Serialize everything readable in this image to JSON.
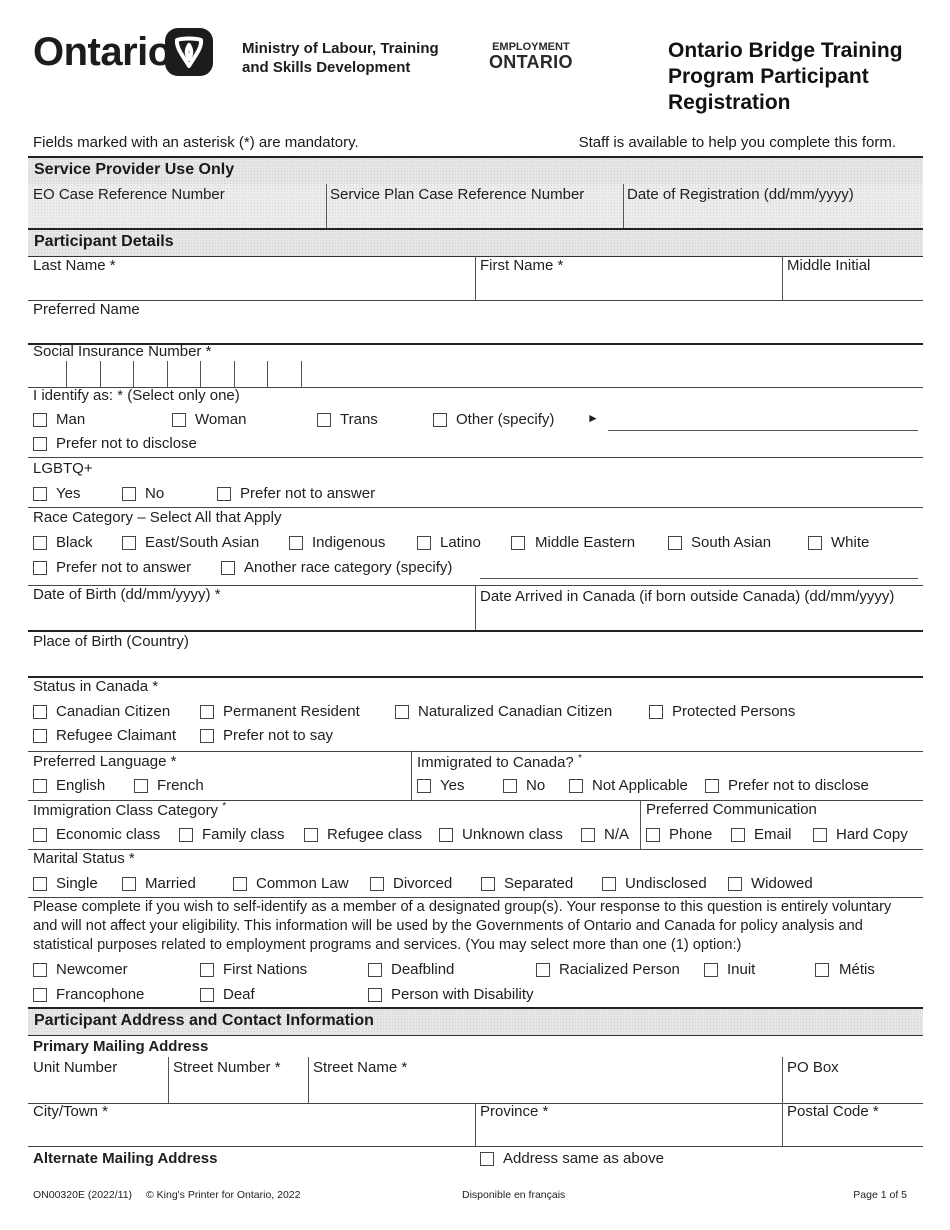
{
  "header": {
    "logo_text": "Ontario",
    "logo_icon": "trillium-icon",
    "ministry_line1": "Ministry of Labour, Training",
    "ministry_line2": "and Skills Development",
    "eo_line1": "EMPLOYMENT",
    "eo_line2": "ONTARIO",
    "title_line1": "Ontario Bridge Training",
    "title_line2": "Program Participant",
    "title_line3": "Registration"
  },
  "notes": {
    "mandatory": "Fields marked with an asterisk (*) are mandatory.",
    "staff": "Staff is available to help you complete this form."
  },
  "service_provider": {
    "heading": "Service Provider Use Only",
    "fields": [
      "EO Case Reference Number",
      "Service Plan Case Reference Number",
      "Date of Registration (dd/mm/yyyy)"
    ]
  },
  "participant": {
    "heading": "Participant Details",
    "last_name": "Last Name *",
    "first_name": "First Name *",
    "middle_initial": "Middle Initial",
    "preferred_name": "Preferred Name",
    "sin": "Social Insurance Number *",
    "identify": {
      "label": "I identify as: * (Select only one)",
      "options": [
        "Man",
        "Woman",
        "Trans",
        "Other (specify)",
        "Prefer not to disclose"
      ],
      "arrow": "►"
    },
    "lgbtq": {
      "label": "LGBTQ+",
      "options": [
        "Yes",
        "No",
        "Prefer not to answer"
      ]
    },
    "race": {
      "label": "Race Category – Select All that Apply",
      "options": [
        "Black",
        "East/South Asian",
        "Indigenous",
        "Latino",
        "Middle Eastern",
        "South Asian",
        "White",
        "Prefer not to answer",
        "Another race category (specify)"
      ]
    },
    "dob": "Date of Birth (dd/mm/yyyy) *",
    "date_arrived": "Date Arrived in Canada (if born outside Canada) (dd/mm/yyyy)",
    "place_of_birth": "Place of Birth (Country)",
    "status": {
      "label": "Status in Canada *",
      "options": [
        "Canadian Citizen",
        "Permanent Resident",
        "Naturalized Canadian Citizen",
        "Protected Persons",
        "Refugee Claimant",
        "Prefer not to say"
      ]
    },
    "language": {
      "label": "Preferred Language *",
      "options": [
        "English",
        "French"
      ]
    },
    "immigrated": {
      "label": "Immigrated to Canada?",
      "asterisk": "*",
      "options": [
        "Yes",
        "No",
        "Not Applicable",
        "Prefer not to disclose"
      ]
    },
    "immigration_class": {
      "label": "Immigration Class Category",
      "asterisk": "*",
      "options": [
        "Economic class",
        "Family class",
        "Refugee class",
        "Unknown class",
        "N/A"
      ]
    },
    "communication": {
      "label": "Preferred Communication",
      "options": [
        "Phone",
        "Email",
        "Hard Copy"
      ]
    },
    "marital": {
      "label": "Marital Status *",
      "options": [
        "Single",
        "Married",
        "Common Law",
        "Divorced",
        "Separated",
        "Undisclosed",
        "Widowed"
      ]
    },
    "designated": {
      "text": "Please complete if you wish to self-identify as a member of a designated group(s). Your response to this question is entirely voluntary and will not affect your eligibility. This information will be used by the Governments of Ontario and Canada for policy analysis and statistical purposes related to employment programs and services. (You may select more than one (1) option:)",
      "options": [
        "Newcomer",
        "First Nations",
        "Deafblind",
        "Racialized Person",
        "Inuit",
        "Métis",
        "Francophone",
        "Deaf",
        "Person with Disability"
      ]
    }
  },
  "address": {
    "heading": "Participant Address and Contact Information",
    "primary": "Primary Mailing Address",
    "unit": "Unit Number",
    "street_number": "Street Number *",
    "street_name": "Street Name *",
    "po_box": "PO Box",
    "city": "City/Town *",
    "province": "Province *",
    "postal": "Postal Code *",
    "alternate": "Alternate Mailing Address",
    "same_as_above": "Address same as above"
  },
  "footer": {
    "form_id": "ON00320E (2022/11)",
    "copyright": "© King's Printer for Ontario, 2022",
    "french": "Disponible en français",
    "page": "Page 1 of 5"
  }
}
